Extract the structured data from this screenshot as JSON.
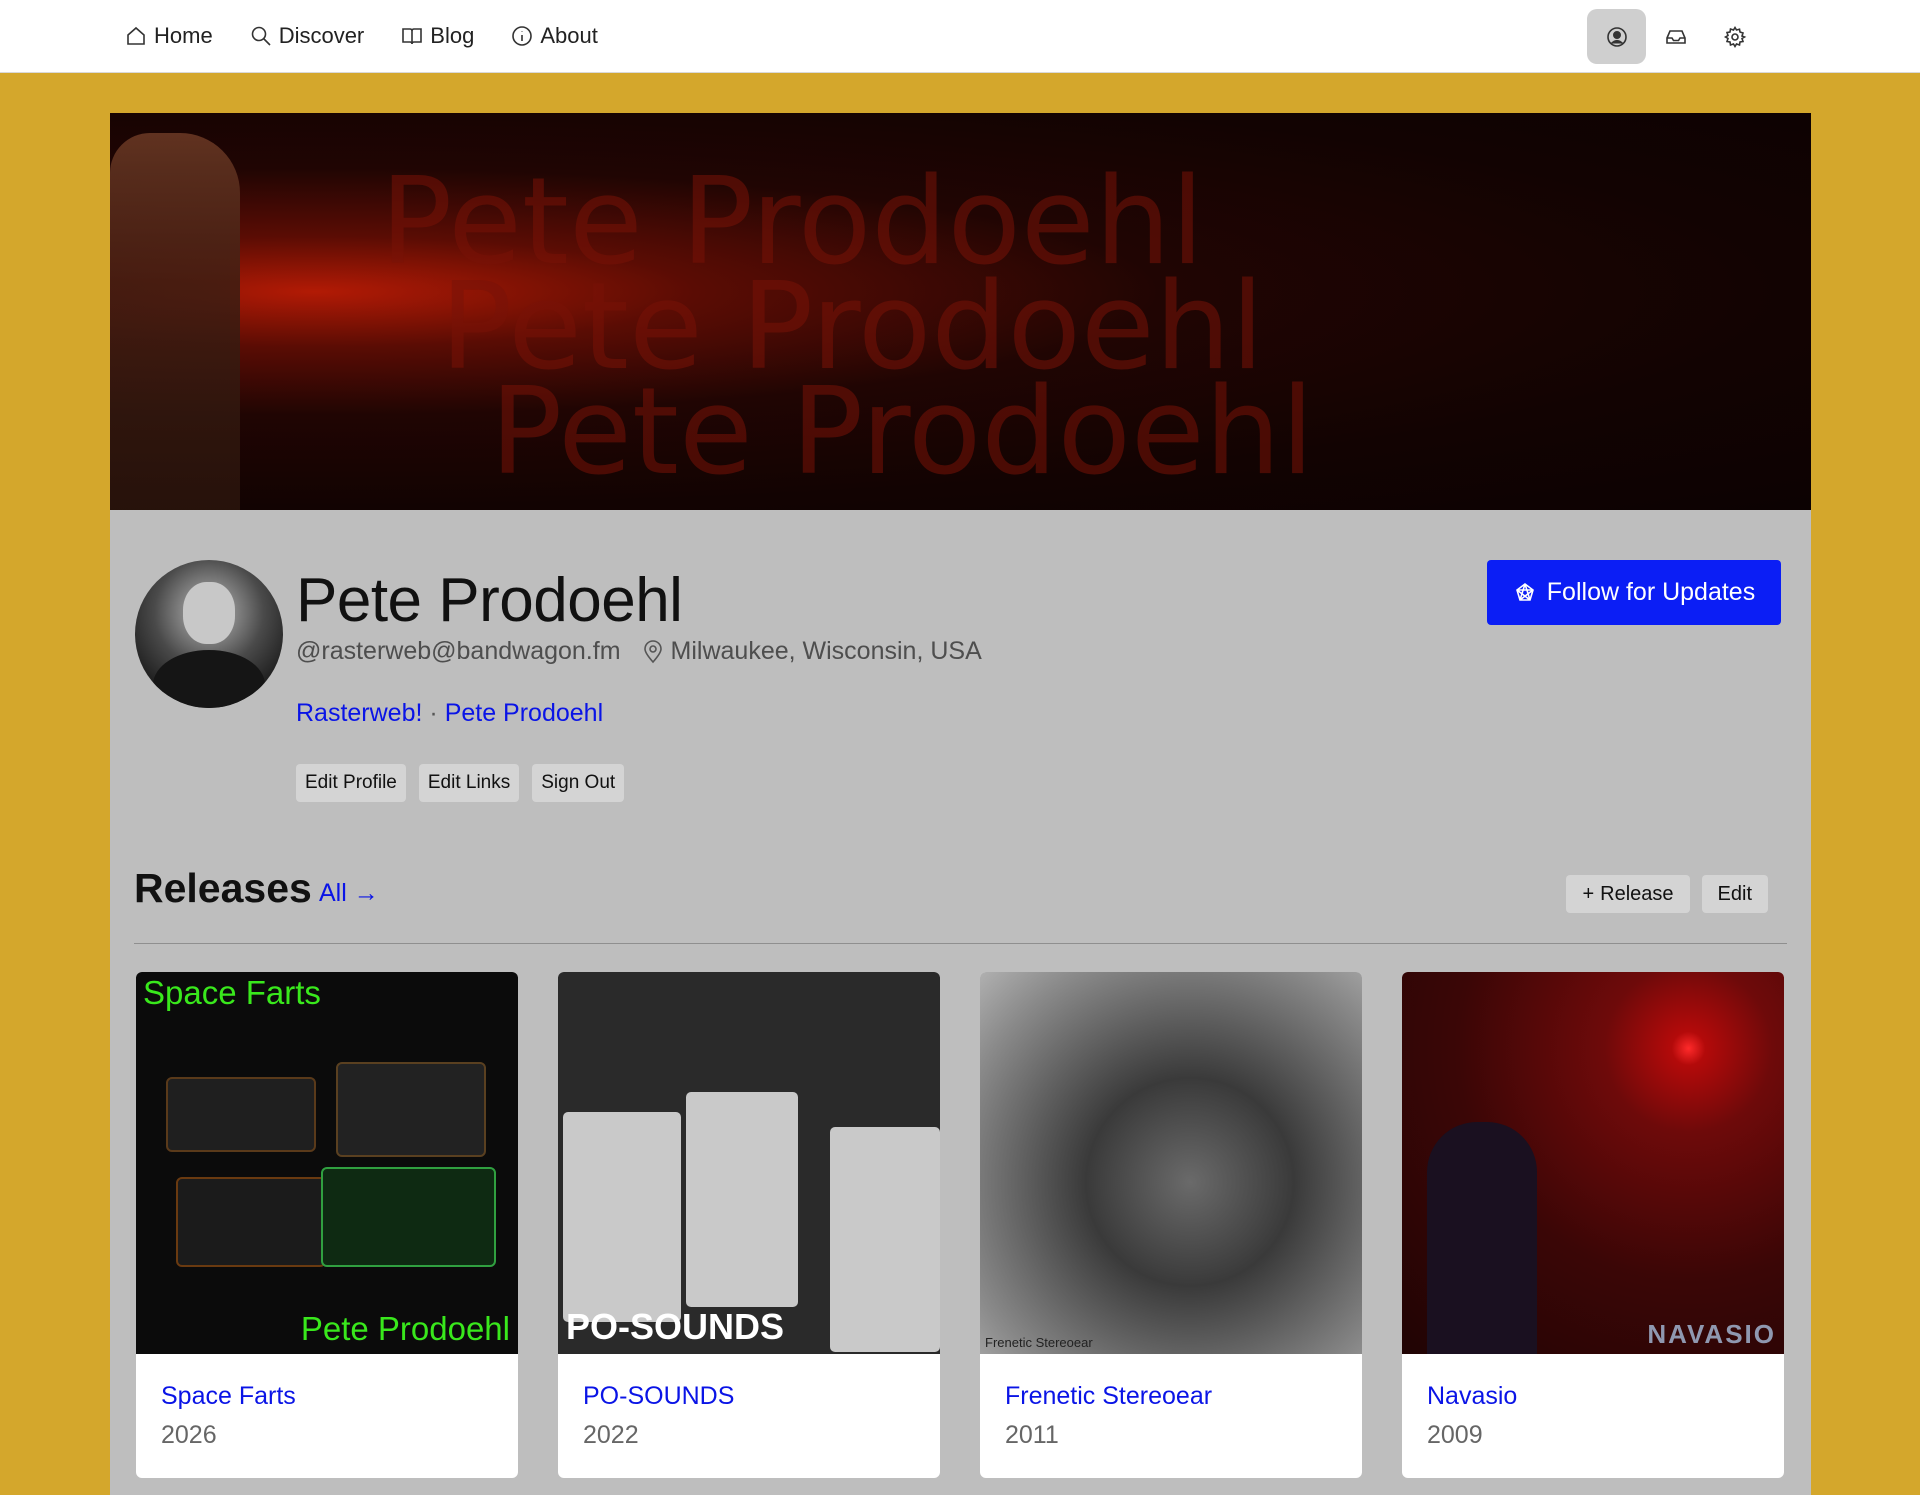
{
  "nav": {
    "items": [
      {
        "label": "Home",
        "icon": "home-icon"
      },
      {
        "label": "Discover",
        "icon": "search-icon"
      },
      {
        "label": "Blog",
        "icon": "book-icon"
      },
      {
        "label": "About",
        "icon": "info-icon"
      }
    ],
    "right_icons": [
      "user-circle-icon",
      "inbox-icon",
      "gear-icon"
    ]
  },
  "profile": {
    "banner_text": "Pete Prodoehl",
    "name": "Pete Prodoehl",
    "handle": "@rasterweb@bandwagon.fm",
    "location": "Milwaukee, Wisconsin, USA",
    "links": [
      "Rasterweb!",
      "Pete Prodoehl"
    ],
    "link_separator": "·",
    "buttons": [
      "Edit Profile",
      "Edit Links",
      "Sign Out"
    ],
    "follow_label": "Follow for Updates"
  },
  "releases": {
    "title": "Releases",
    "all_label": "All →",
    "add_label": "Release",
    "edit_label": "Edit",
    "items": [
      {
        "title": "Space Farts",
        "year": "2026",
        "cover_top": "Space Farts",
        "cover_bottom": "Pete Prodoehl"
      },
      {
        "title": "PO-SOUNDS",
        "year": "2022",
        "cover_text": "PO-SOUNDS"
      },
      {
        "title": "Frenetic Stereoear",
        "year": "2011",
        "cover_text": "Frenetic Stereoear"
      },
      {
        "title": "Navasio",
        "year": "2009",
        "cover_text": "NAVASIO"
      }
    ]
  },
  "colors": {
    "page_bg": "#d4a72c",
    "panel_bg": "#bebebe",
    "link": "#0a14e6",
    "follow_button": "#0b1ef5"
  }
}
